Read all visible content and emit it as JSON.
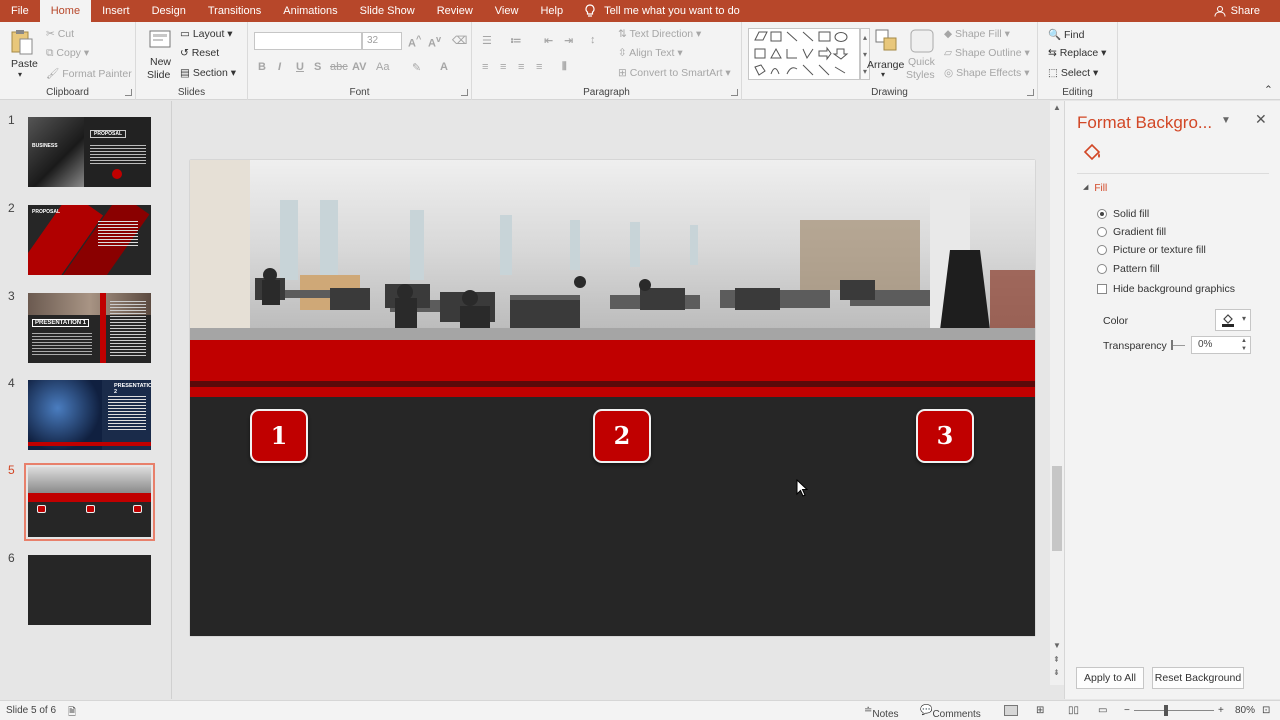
{
  "tabs": [
    {
      "label": "File",
      "active": false
    },
    {
      "label": "Home",
      "active": true
    },
    {
      "label": "Insert",
      "active": false
    },
    {
      "label": "Design",
      "active": false
    },
    {
      "label": "Transitions",
      "active": false
    },
    {
      "label": "Animations",
      "active": false
    },
    {
      "label": "Slide Show",
      "active": false
    },
    {
      "label": "Review",
      "active": false
    },
    {
      "label": "View",
      "active": false
    },
    {
      "label": "Help",
      "active": false
    }
  ],
  "tell_me": "Tell me what you want to do",
  "share": "Share",
  "ribbon": {
    "clipboard": {
      "paste": "Paste",
      "cut": "Cut",
      "copy": "Copy",
      "format_painter": "Format Painter",
      "label": "Clipboard"
    },
    "slides": {
      "new_slide_1": "New",
      "new_slide_2": "Slide",
      "layout": "Layout",
      "reset": "Reset",
      "section": "Section",
      "label": "Slides"
    },
    "font": {
      "font_name": "",
      "font_size": "32",
      "bold": "B",
      "italic": "I",
      "underline": "U",
      "shadow": "S",
      "strike": "abc",
      "spacing": "AV",
      "case": "Aa",
      "label": "Font"
    },
    "paragraph": {
      "text_direction": "Text Direction",
      "align_text": "Align Text",
      "convert_smartart": "Convert to SmartArt",
      "label": "Paragraph"
    },
    "drawing": {
      "arrange": "Arrange",
      "quick_styles_1": "Quick",
      "quick_styles_2": "Styles",
      "shape_fill": "Shape Fill",
      "shape_outline": "Shape Outline",
      "shape_effects": "Shape Effects",
      "label": "Drawing"
    },
    "editing": {
      "find": "Find",
      "replace": "Replace",
      "select": "Select",
      "label": "Editing"
    }
  },
  "thumbnails": [
    {
      "num": "1",
      "title": "PROPOSAL",
      "subtitle": "BUSINESS"
    },
    {
      "num": "2",
      "title": "PROPOSAL"
    },
    {
      "num": "3",
      "title": "PRESENTATION 1"
    },
    {
      "num": "4",
      "title": "PRESENTATION 2"
    },
    {
      "num": "5",
      "active": true
    },
    {
      "num": "6"
    }
  ],
  "slide": {
    "boxes": [
      "1",
      "2",
      "3"
    ],
    "accent_color": "#c00000",
    "background_color": "#262626"
  },
  "format_pane": {
    "title": "Format Backgro...",
    "section": "Fill",
    "options": [
      {
        "label": "Solid fill",
        "selected": true
      },
      {
        "label": "Gradient fill",
        "selected": false
      },
      {
        "label": "Picture or texture fill",
        "selected": false
      },
      {
        "label": "Pattern fill",
        "selected": false
      }
    ],
    "hide_graphics": "Hide background graphics",
    "color_label": "Color",
    "transparency_label": "Transparency",
    "transparency_value": "0%",
    "apply_all": "Apply to All",
    "reset_bg": "Reset Background"
  },
  "status": {
    "slide_info": "Slide 5 of 6",
    "notes": "Notes",
    "comments": "Comments",
    "zoom": "80%"
  },
  "colors": {
    "ppt_accent": "#b7472a",
    "pane_title": "#d24726"
  }
}
